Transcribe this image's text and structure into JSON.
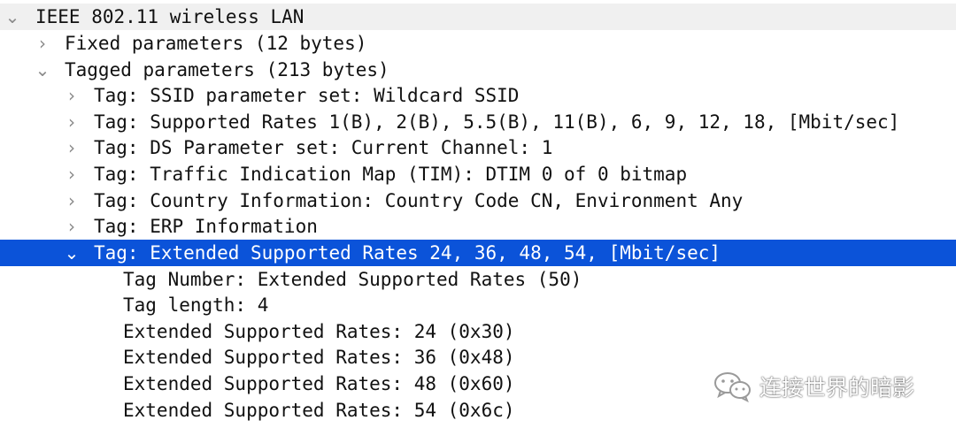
{
  "tree": {
    "rows": [
      {
        "text": "IEEE 802.11 wireless LAN",
        "expanded": true
      },
      {
        "text": "Fixed parameters (12 bytes)",
        "expanded": false
      },
      {
        "text": "Tagged parameters (213 bytes)",
        "expanded": true
      },
      {
        "text": "Tag: SSID parameter set: Wildcard SSID",
        "expanded": false
      },
      {
        "text": "Tag: Supported Rates 1(B), 2(B), 5.5(B), 11(B), 6, 9, 12, 18, [Mbit/sec]",
        "expanded": false
      },
      {
        "text": "Tag: DS Parameter set: Current Channel: 1",
        "expanded": false
      },
      {
        "text": "Tag: Traffic Indication Map (TIM): DTIM 0 of 0 bitmap",
        "expanded": false
      },
      {
        "text": "Tag: Country Information: Country Code CN, Environment Any",
        "expanded": false
      },
      {
        "text": "Tag: ERP Information",
        "expanded": false
      },
      {
        "text": "Tag: Extended Supported Rates 24, 36, 48, 54, [Mbit/sec]",
        "expanded": true,
        "selected": true
      },
      {
        "text": "Tag Number: Extended Supported Rates (50)"
      },
      {
        "text": "Tag length: 4"
      },
      {
        "text": "Extended Supported Rates: 24 (0x30)"
      },
      {
        "text": "Extended Supported Rates: 36 (0x48)"
      },
      {
        "text": "Extended Supported Rates: 48 (0x60)"
      },
      {
        "text": "Extended Supported Rates: 54 (0x6c)"
      }
    ]
  },
  "watermark": {
    "text": "连接世界的暗影",
    "icon": "wechat-icon"
  },
  "colors": {
    "selection": "#0b53d9",
    "header_bg": "#f0f0f0",
    "arrow": "#8a8a8a"
  }
}
